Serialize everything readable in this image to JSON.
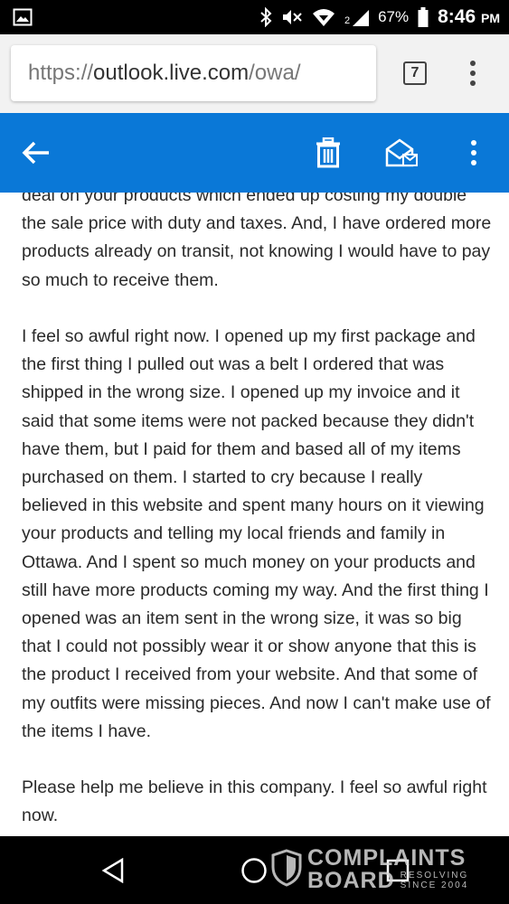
{
  "status_bar": {
    "battery": "67%",
    "time": "8:46",
    "ampm": "PM",
    "signal_label": "2",
    "icons": [
      "image-icon",
      "bluetooth-icon",
      "mute-icon",
      "wifi-icon",
      "signal-icon",
      "battery-icon"
    ]
  },
  "browser": {
    "url_scheme": "https://",
    "url_host": "outlook.live.com",
    "url_path": "/owa/",
    "tab_count": "7"
  },
  "toolbar": {
    "icons": [
      "back-arrow-icon",
      "trash-icon",
      "mark-read-icon",
      "more-icon"
    ],
    "accent_color": "#0a78d7"
  },
  "message": {
    "paragraphs": [
      "deal on your products which ended up costing my double the sale price with duty and taxes. And, I have ordered more products already on transit, not knowing I would have to pay so much to receive them.",
      "I feel so awful right now. I opened up my first package and the first thing I pulled out was a belt I ordered that was shipped in the wrong size. I opened up my invoice and it said that some items were not packed because they didn't have them, but I paid for them and based all of my items purchased on them. I started to cry because I really believed in this website and spent many hours on it viewing your products and telling my local friends and family in Ottawa. And I spent so much money on your products and still have more products coming my way. And the first thing I opened was an item sent in the wrong size, it was so big that I could not possibly wear it or show anyone that this is the product I received from your website. And that some of my outfits were missing pieces. And now I can't make use of the items I have.",
      "Please help me believe in this company. I feel so awful right now."
    ]
  },
  "watermark": {
    "line1": "COMPLAINTS",
    "line2": "BOARD",
    "tag1": "RESOLVING",
    "tag2": "SINCE 2004"
  }
}
